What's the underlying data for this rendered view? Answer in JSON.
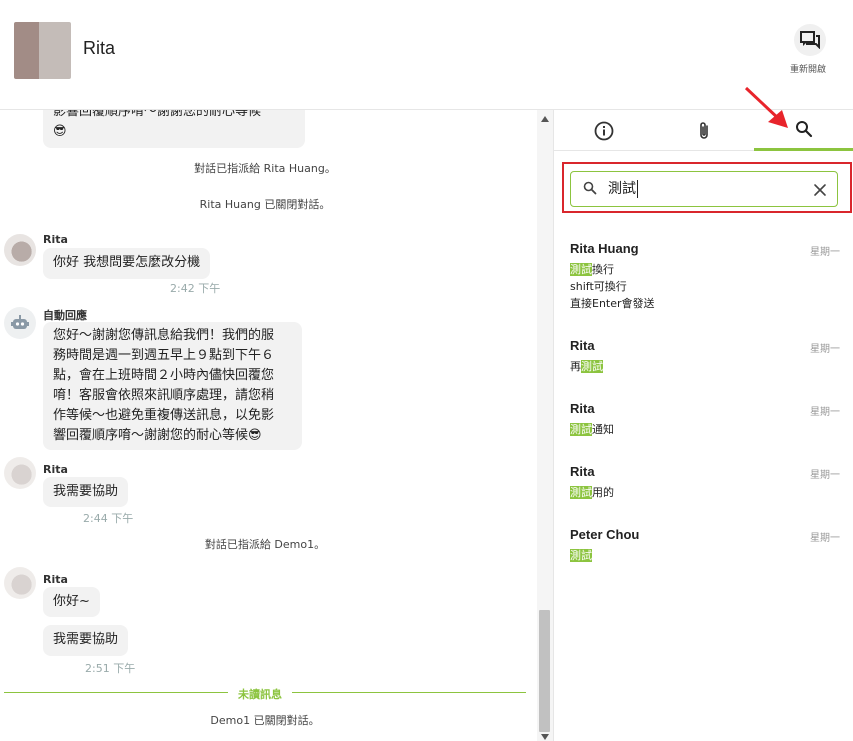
{
  "header": {
    "contact_name": "Rita",
    "new_conversation_label": "重新開啟"
  },
  "chat": {
    "top_partial_text": "影響回覆順序唷～謝謝您的耐心等候",
    "top_partial_emoji": "😎",
    "sys1": "對話已指派給 Rita Huang。",
    "sys2": "Rita Huang 已關閉對話。",
    "msg1": {
      "sender": "Rita",
      "text": "你好 我想問要怎麼改分機",
      "time": "2:42 下午"
    },
    "bot": {
      "sender": "自動回應",
      "lines": [
        "您好～謝謝您傳訊息給我們！我們的服",
        "務時間是週一到週五早上９點到下午６",
        "點，會在上班時間２小時內儘快回覆您",
        "唷！客服會依照來訊順序處理，請您稍",
        "作等候～也避免重複傳送訊息，以免影",
        "響回覆順序唷～謝謝您的耐心等候😎"
      ]
    },
    "msg2": {
      "sender": "Rita",
      "text": "我需要協助",
      "time": "2:44 下午"
    },
    "sys3": "對話已指派給 Demo1。",
    "msg3": {
      "sender": "Rita",
      "text1": "你好~",
      "text2": "我需要協助",
      "time": "2:51 下午"
    },
    "unread_label": "未讀訊息",
    "sys4": "Demo1 已關閉對話。"
  },
  "search": {
    "value": "測試",
    "results": [
      {
        "name": "Rita Huang",
        "day": "星期一",
        "lines": [
          {
            "hl": "測試",
            "rest": "換行"
          },
          {
            "hl": "",
            "rest": "shift可換行"
          },
          {
            "hl": "",
            "rest": "直接Enter會發送"
          }
        ]
      },
      {
        "name": "Rita",
        "day": "星期一",
        "pre": "再",
        "hl": "測試",
        "rest": ""
      },
      {
        "name": "Rita",
        "day": "星期一",
        "pre": "",
        "hl": "測試",
        "rest": "通知"
      },
      {
        "name": "Rita",
        "day": "星期一",
        "pre": "",
        "hl": "測試",
        "rest": "用的"
      },
      {
        "name": "Peter Chou",
        "day": "星期一",
        "pre": "",
        "hl": "測試",
        "rest": ""
      }
    ]
  },
  "colors": {
    "accent": "#8cc43f",
    "highlight_box": "#d9262c",
    "bubble": "#f2f2f2"
  }
}
